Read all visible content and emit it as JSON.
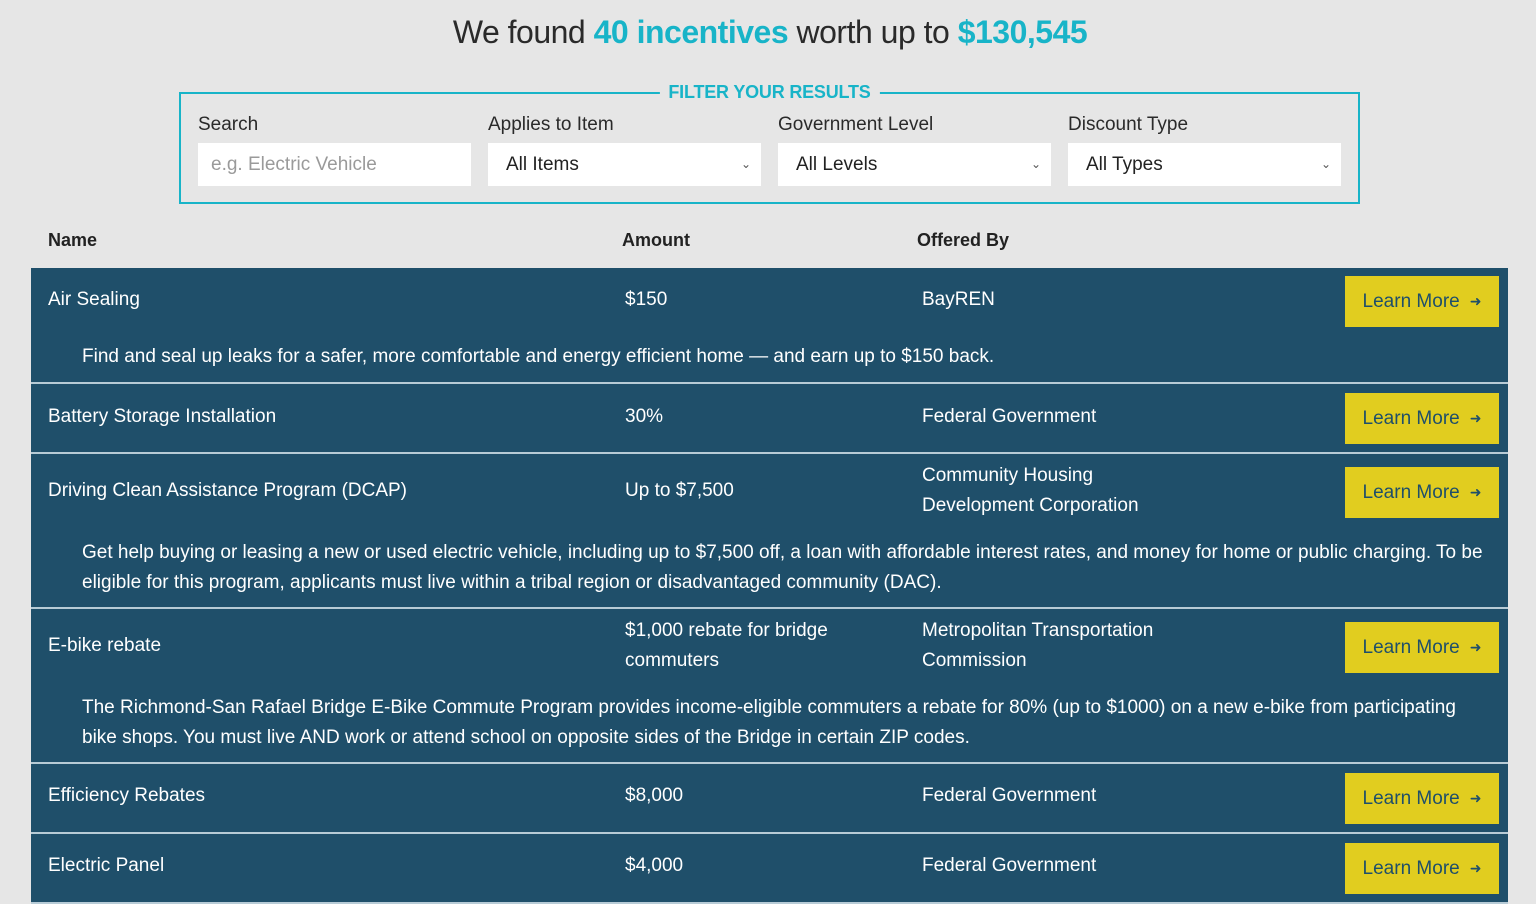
{
  "headline": {
    "prefix": "We found ",
    "count": "40 incentives",
    "middle": " worth up to ",
    "total": "$130,545"
  },
  "filters": {
    "legend": "FILTER YOUR RESULTS",
    "search": {
      "label": "Search",
      "placeholder": "e.g. Electric Vehicle",
      "value": ""
    },
    "item": {
      "label": "Applies to Item",
      "value": "All Items"
    },
    "level": {
      "label": "Government Level",
      "value": "All Levels"
    },
    "discount": {
      "label": "Discount Type",
      "value": "All Types"
    }
  },
  "table": {
    "headers": {
      "name": "Name",
      "amount": "Amount",
      "offered_by": "Offered By"
    },
    "button_label": "Learn More",
    "rows": [
      {
        "name": "Air Sealing",
        "amount": "$150",
        "offered_by": "BayREN",
        "description": "Find and seal up leaks for a safer, more comfortable and energy efficient home — and earn up to $150 back."
      },
      {
        "name": "Battery Storage Installation",
        "amount": "30%",
        "offered_by": "Federal Government",
        "description": ""
      },
      {
        "name": "Driving Clean Assistance Program (DCAP)",
        "amount": "Up to $7,500",
        "offered_by": "Community Housing Development Corporation",
        "description": "Get help buying or leasing a new or used electric vehicle, including up to $7,500 off, a loan with affordable interest rates, and money for home or public charging. To be eligible for this program, applicants must live within a tribal region or disadvantaged community (DAC)."
      },
      {
        "name": "E-bike rebate",
        "amount": "$1,000 rebate for bridge commuters",
        "offered_by": "Metropolitan Transportation Commission",
        "description": "The Richmond-San Rafael Bridge E-Bike Commute Program provides income-eligible commuters a rebate for 80% (up to $1000) on a new e-bike from participating bike shops. You must live AND work or attend school on opposite sides of the Bridge in certain ZIP codes."
      },
      {
        "name": "Efficiency Rebates",
        "amount": "$8,000",
        "offered_by": "Federal Government",
        "description": ""
      },
      {
        "name": "Electric Panel",
        "amount": "$4,000",
        "offered_by": "Federal Government",
        "description": ""
      }
    ]
  }
}
